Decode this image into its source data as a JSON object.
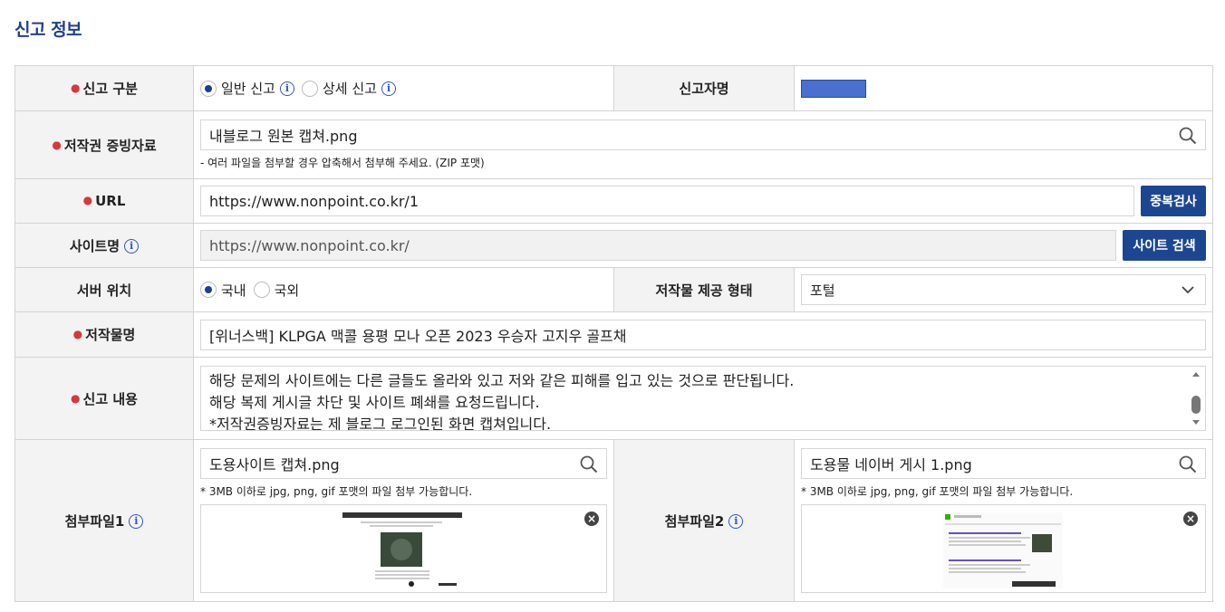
{
  "section_title": "신고 정보",
  "report_type": {
    "label": "신고 구분",
    "options": [
      {
        "label": "일반 신고",
        "selected": true
      },
      {
        "label": "상세 신고",
        "selected": false
      }
    ]
  },
  "reporter": {
    "label": "신고자명"
  },
  "evidence": {
    "label": "저작권 증빙자료",
    "value": "내블로그 원본 캡쳐.png",
    "hint": "- 여러 파일을 첨부할 경우 압축해서 첨부해 주세요. (ZIP 포맷)"
  },
  "url": {
    "label": "URL",
    "value": "https://www.nonpoint.co.kr/1",
    "button": "중복검사"
  },
  "site_name": {
    "label": "사이트명",
    "value": "https://www.nonpoint.co.kr/",
    "button": "사이트 검색"
  },
  "server_location": {
    "label": "서버 위치",
    "options": [
      {
        "label": "국내",
        "selected": true
      },
      {
        "label": "국외",
        "selected": false
      }
    ]
  },
  "provision_type": {
    "label": "저작물 제공 형태",
    "value": "포털"
  },
  "work_title": {
    "label": "저작물명",
    "value": "[위너스백] KLPGA 맥콜 용평 모나 오픈 2023 우승자 고지우 골프채"
  },
  "report_content": {
    "label": "신고 내용",
    "lines": [
      "해당 문제의 사이트에는 다른 글들도 올라와 있고 저와 같은 피해를 입고 있는 것으로 판단됩니다.",
      "해당 복제 게시글 차단 및 사이트 폐쇄를 요청드립니다.",
      "*저작권증빙자료는 제 블로그 로그인된 화면 캡쳐입니다."
    ]
  },
  "attachment1": {
    "label": "첨부파일1",
    "value": "도용사이트 캡쳐.png",
    "hint": "* 3MB 이하로 jpg, png, gif 포맷의 파일 첨부 가능합니다."
  },
  "attachment2": {
    "label": "첨부파일2",
    "value": "도용물 네이버 게시 1.png",
    "hint": "* 3MB 이하로 jpg, png, gif 포맷의 파일 첨부 가능합니다."
  },
  "colors": {
    "title": "#1f3f8f",
    "button": "#1d4690",
    "required": "#d9373b",
    "info": "#2f57c4"
  },
  "icons": [
    "search-icon",
    "info-icon",
    "chevron-down-icon",
    "close-icon"
  ]
}
